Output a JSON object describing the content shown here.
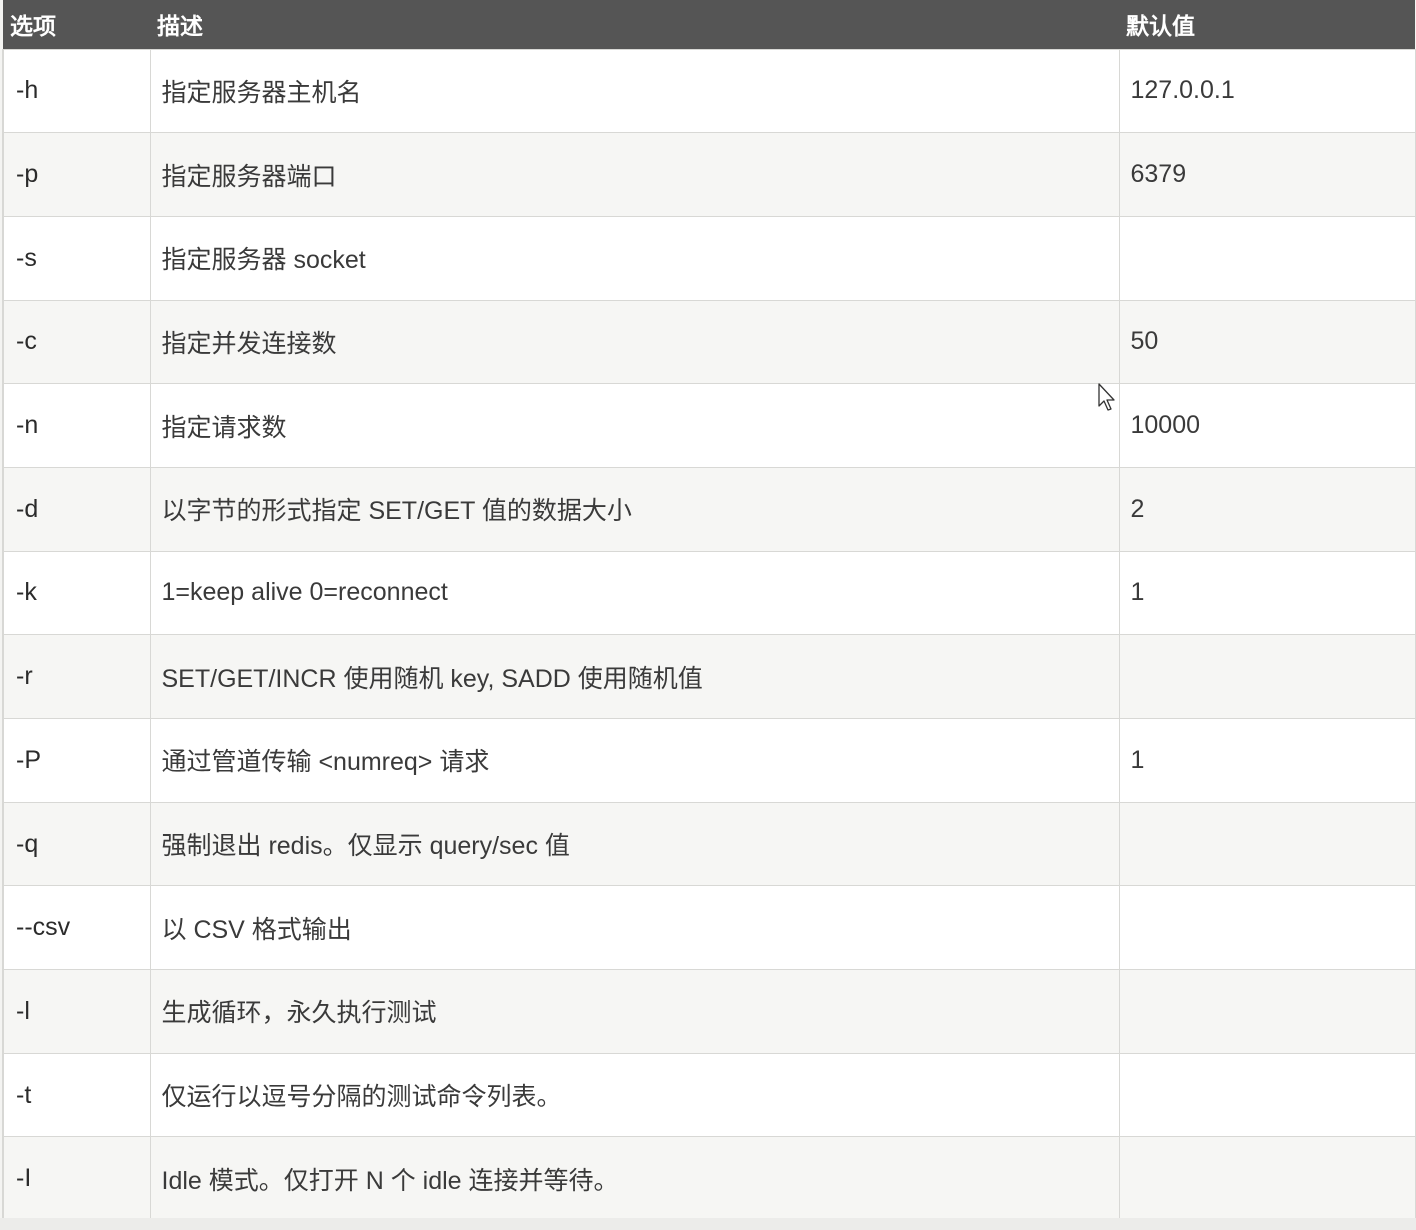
{
  "table": {
    "headers": {
      "option": "选项",
      "description": "描述",
      "default": "默认值"
    },
    "rows": [
      {
        "option": "-h",
        "description": "指定服务器主机名",
        "default": "127.0.0.1"
      },
      {
        "option": "-p",
        "description": "指定服务器端口",
        "default": "6379"
      },
      {
        "option": "-s",
        "description": "指定服务器 socket",
        "default": ""
      },
      {
        "option": "-c",
        "description": "指定并发连接数",
        "default": "50"
      },
      {
        "option": "-n",
        "description": "指定请求数",
        "default": "10000"
      },
      {
        "option": "-d",
        "description": "以字节的形式指定 SET/GET 值的数据大小",
        "default": "2"
      },
      {
        "option": "-k",
        "description": "1=keep alive 0=reconnect",
        "default": "1"
      },
      {
        "option": "-r",
        "description": "SET/GET/INCR 使用随机 key, SADD 使用随机值",
        "default": ""
      },
      {
        "option": "-P",
        "description": "通过管道传输 <numreq> 请求",
        "default": "1"
      },
      {
        "option": "-q",
        "description": "强制退出 redis。仅显示 query/sec 值",
        "default": ""
      },
      {
        "option": "--csv",
        "description": "以 CSV 格式输出",
        "default": ""
      },
      {
        "option": "-l",
        "description": "生成循环，永久执行测试",
        "default": ""
      },
      {
        "option": "-t",
        "description": "仅运行以逗号分隔的测试命令列表。",
        "default": ""
      },
      {
        "option": "-I",
        "description": "Idle 模式。仅打开 N 个 idle 连接并等待。",
        "default": ""
      }
    ]
  },
  "cursor": {
    "icon": "mouse-pointer-icon"
  },
  "colors": {
    "header_bg": "#555555",
    "header_text": "#ffffff",
    "row_odd": "#ffffff",
    "row_even": "#f6f6f4",
    "border": "#d8d8d5"
  }
}
